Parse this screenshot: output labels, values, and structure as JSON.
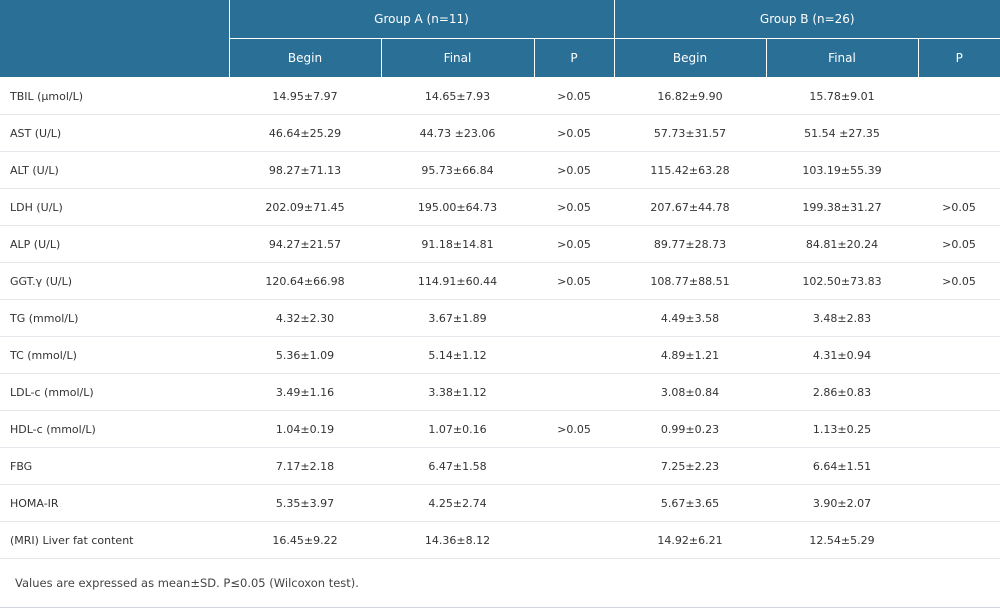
{
  "header": {
    "group_a": "Group A (n=11)",
    "group_b": "Group B (n=26)",
    "columns": [
      "Begin",
      "Final",
      "P",
      "Begin",
      "Final",
      "P"
    ]
  },
  "rows": [
    {
      "label": "TBIL (µmol/L)",
      "a_begin": "14.95±7.97",
      "a_final": "14.65±7.93",
      "a_p": ">0.05",
      "b_begin": "16.82±9.90",
      "b_final": "15.78±9.01",
      "b_p": ""
    },
    {
      "label": "AST (U/L)",
      "a_begin": "46.64±25.29",
      "a_final": "44.73 ±23.06",
      "a_p": ">0.05",
      "b_begin": "57.73±31.57",
      "b_final": "51.54 ±27.35",
      "b_p": ""
    },
    {
      "label": "ALT (U/L)",
      "a_begin": "98.27±71.13",
      "a_final": "95.73±66.84",
      "a_p": ">0.05",
      "b_begin": "115.42±63.28",
      "b_final": "103.19±55.39",
      "b_p": ""
    },
    {
      "label": "LDH (U/L)",
      "a_begin": "202.09±71.45",
      "a_final": "195.00±64.73",
      "a_p": ">0.05",
      "b_begin": "207.67±44.78",
      "b_final": "199.38±31.27",
      "b_p": ">0.05"
    },
    {
      "label": "ALP (U/L)",
      "a_begin": "94.27±21.57",
      "a_final": "91.18±14.81",
      "a_p": ">0.05",
      "b_begin": "89.77±28.73",
      "b_final": "84.81±20.24",
      "b_p": ">0.05"
    },
    {
      "label": "GGT.γ (U/L)",
      "a_begin": "120.64±66.98",
      "a_final": "114.91±60.44",
      "a_p": ">0.05",
      "b_begin": "108.77±88.51",
      "b_final": "102.50±73.83",
      "b_p": ">0.05"
    },
    {
      "label": "TG (mmol/L)",
      "a_begin": "4.32±2.30",
      "a_final": "3.67±1.89",
      "a_p": "",
      "b_begin": "4.49±3.58",
      "b_final": "3.48±2.83",
      "b_p": ""
    },
    {
      "label": "TC (mmol/L)",
      "a_begin": "5.36±1.09",
      "a_final": "5.14±1.12",
      "a_p": "",
      "b_begin": "4.89±1.21",
      "b_final": "4.31±0.94",
      "b_p": ""
    },
    {
      "label": "LDL-c (mmol/L)",
      "a_begin": "3.49±1.16",
      "a_final": "3.38±1.12",
      "a_p": "",
      "b_begin": "3.08±0.84",
      "b_final": "2.86±0.83",
      "b_p": ""
    },
    {
      "label": "HDL-c (mmol/L)",
      "a_begin": "1.04±0.19",
      "a_final": "1.07±0.16",
      "a_p": ">0.05",
      "b_begin": "0.99±0.23",
      "b_final": "1.13±0.25",
      "b_p": ""
    },
    {
      "label": "FBG",
      "a_begin": "7.17±2.18",
      "a_final": "6.47±1.58",
      "a_p": "",
      "b_begin": "7.25±2.23",
      "b_final": "6.64±1.51",
      "b_p": ""
    },
    {
      "label": "HOMA-IR",
      "a_begin": "5.35±3.97",
      "a_final": "4.25±2.74",
      "a_p": "",
      "b_begin": "5.67±3.65",
      "b_final": "3.90±2.07",
      "b_p": ""
    },
    {
      "label": "(MRI) Liver fat content",
      "a_begin": "16.45±9.22",
      "a_final": "14.36±8.12",
      "a_p": "",
      "b_begin": "14.92±6.21",
      "b_final": "12.54±5.29",
      "b_p": ""
    }
  ],
  "footnote": "Values are expressed as mean±SD. P≤0.05 (Wilcoxon test).",
  "colors": {
    "header_bg": "#2a6f96",
    "header_text": "#ffffff",
    "row_border": "#e3e7eb"
  }
}
